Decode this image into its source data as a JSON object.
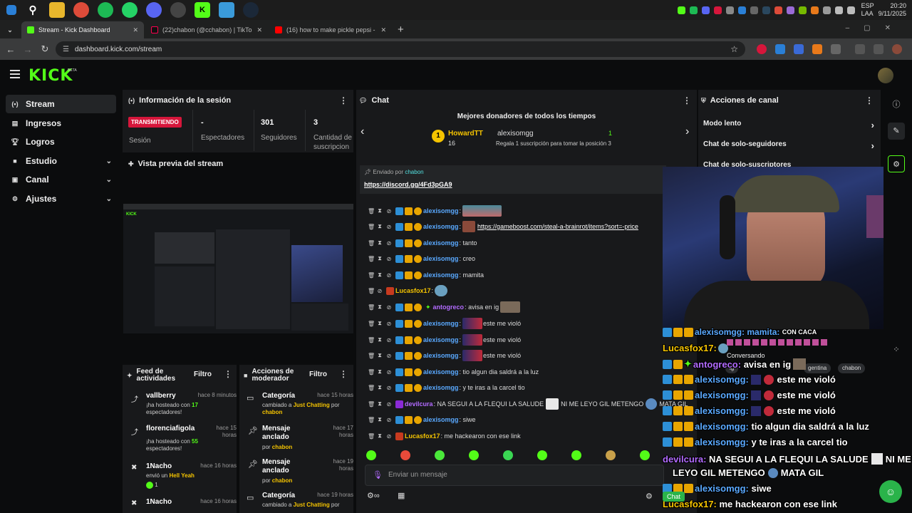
{
  "taskbar": {
    "clock_time": "20:20",
    "clock_date": "9/11/2025",
    "lang_top": "ESP",
    "lang_bottom": "LAA"
  },
  "browser": {
    "tabs": [
      {
        "title": "Stream - Kick Dashboard"
      },
      {
        "title": "(22)chabon (@cchabon) | TikTok"
      },
      {
        "title": "(16) how to make pickle pepsi - ..."
      }
    ],
    "new_tab": "+",
    "url": "dashboard.kick.com/stream"
  },
  "kick": {
    "logo": "KICK",
    "beta": "BETA"
  },
  "sidebar": {
    "items": [
      {
        "label": "Stream",
        "icon": "signal-icon"
      },
      {
        "label": "Ingresos",
        "icon": "revenue-icon"
      },
      {
        "label": "Logros",
        "icon": "trophy-icon"
      },
      {
        "label": "Estudio",
        "icon": "studio-icon"
      },
      {
        "label": "Canal",
        "icon": "channel-icon"
      },
      {
        "label": "Ajustes",
        "icon": "gear-icon"
      }
    ]
  },
  "session": {
    "title": "Información de la sesión",
    "live_badge": "TRANSMITIENDO",
    "session_label": "Sesión",
    "viewers_value": "-",
    "viewers_label": "Espectadores",
    "followers_value": "301",
    "followers_label": "Seguidores",
    "subs_value": "3",
    "subs_label_1": "Cantidad de",
    "subs_label_2": "suscripcion"
  },
  "preview": {
    "title": "Vista previa del stream"
  },
  "activity_feed": {
    "title_1": "Feed de",
    "title_2": "actividades",
    "filter": "Filtro",
    "items": [
      {
        "name": "vallberry",
        "time": "hace 8 minutos",
        "desc_pre": "¡ha hosteado con ",
        "desc_num": "17",
        "desc_post": "espectadores!"
      },
      {
        "name": "florenciafigola",
        "time_1": "hace 15",
        "time_2": "horas",
        "desc_pre": "¡ha hosteado con ",
        "desc_num": "55",
        "desc_post": "espectadores!"
      },
      {
        "name": "1Nacho",
        "time": "hace 16 horas",
        "desc_pre": "envió un ",
        "desc_gift": "Hell Yeah",
        "desc_count": "1"
      },
      {
        "name": "1Nacho",
        "time": "hace 16 horas"
      }
    ]
  },
  "mod_actions": {
    "title_1": "Acciones de",
    "title_2": "moderador",
    "filter": "Filtro",
    "items": [
      {
        "title": "Categoría",
        "time": "hace 15 horas",
        "desc_pre": "cambiado a ",
        "desc_cat": "Just Chatting",
        "desc_mid": " por",
        "desc_user": "chabon"
      },
      {
        "title_1": "Mensaje",
        "title_2": "anclado",
        "time_1": "hace 17",
        "time_2": "horas",
        "desc_pre": "por ",
        "desc_user": "chabon"
      },
      {
        "title_1": "Mensaje",
        "title_2": "anclado",
        "time_1": "hace 19",
        "time_2": "horas",
        "desc_pre": "por ",
        "desc_user": "chabon"
      },
      {
        "title": "Categoría",
        "time": "hace 19 horas",
        "desc_pre": "cambiado a ",
        "desc_cat": "Just Chatting",
        "desc_mid": " por"
      }
    ]
  },
  "chat": {
    "title": "Chat",
    "top_donors_title": "Mejores donadores de todos los tiempos",
    "donor_rank": "1",
    "donor_name": "HowardTT",
    "donor_count": "16",
    "second_name": "alexisomgg",
    "second_count": "1",
    "second_hint": "Regala 1 suscripción para tomar la posición 3",
    "pinned_by_label": "Enviado por",
    "pinned_by_user": "chabon",
    "pinned_link": "https://discord.gg/4Fd3pGA9",
    "messages": [
      {
        "user": "alexisomgg",
        "text": ""
      },
      {
        "user": "alexisomgg",
        "text": "https://gameboost.com/steal-a-brainrot/items?sort=-price"
      },
      {
        "user": "alexisomgg",
        "text": "tanto"
      },
      {
        "user": "alexisomgg",
        "text": "creo"
      },
      {
        "user": "alexisomgg",
        "text": "mamita"
      },
      {
        "user": "Lucasfox17",
        "text": ""
      },
      {
        "user": "antogreco",
        "text": "avisa en ig"
      },
      {
        "user": "alexisomgg",
        "text": "este me violó"
      },
      {
        "user": "alexisomgg",
        "text": "este me violó"
      },
      {
        "user": "alexisomgg",
        "text": "este me violó"
      },
      {
        "user": "alexisomgg",
        "text": "tio algun dia saldrá a la luz"
      },
      {
        "user": "alexisomgg",
        "text": "y te iras a la carcel tio"
      },
      {
        "user": "devilcura",
        "text": "NA SEGUI A LA FLEQUI LA SALUDE",
        "text2": "NI ME LEYO GIL METENGO",
        "text3": "MATA GIL"
      },
      {
        "user": "alexisomgg",
        "text": "siwe"
      },
      {
        "user": "Lucasfox17",
        "text": "me hackearon con ese link"
      }
    ],
    "input_placeholder": "Enviar un mensaje"
  },
  "channel_actions": {
    "title": "Acciones de canal",
    "items": [
      "Modo lento",
      "Chat de solo-seguidores",
      "Chat de solo-suscriptores"
    ]
  },
  "overlay": {
    "top_text": "alexisomgg: mamita:",
    "top_text2": "CON CACA",
    "conversando": "Conversando",
    "chips": [
      "ig",
      "gentina",
      "chabon"
    ],
    "chat_button": "Chat",
    "lines": [
      {
        "user": "Lucasfox17:",
        "text": ""
      },
      {
        "user": "antogreco:",
        "text": "avisa en ig"
      },
      {
        "user": "alexisomgg:",
        "text": "este me violó"
      },
      {
        "user": "alexisomgg:",
        "text": "este me violó"
      },
      {
        "user": "alexisomgg:",
        "text": "este me violó"
      },
      {
        "user": "alexisomgg:",
        "text": "tio algun dia saldrá a la luz"
      },
      {
        "user": "alexisomgg:",
        "text": "y te iras a la carcel tio"
      },
      {
        "user": "devilcura:",
        "text": "NA SEGUI A LA FLEQUI LA SALUDE",
        "text2": "NI ME"
      },
      {
        "user": "",
        "text": "LEYO GIL METENGO",
        "text2": "MATA GIL"
      },
      {
        "user": "alexisomgg:",
        "text": "siwe"
      },
      {
        "user": "Lucasfox17:",
        "text": "me hackearon con ese link"
      }
    ]
  },
  "colors": {
    "kick_green": "#53fc18",
    "live_red": "#d6163b",
    "username_blue": "#5aa9ff",
    "username_gold": "#f5c400",
    "username_purple": "#b26bff"
  }
}
